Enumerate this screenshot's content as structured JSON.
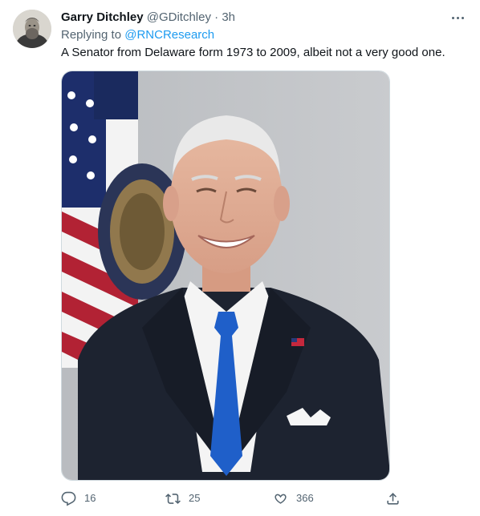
{
  "tweet": {
    "display_name": "Garry Ditchley",
    "handle": "@GDitchley",
    "separator": "·",
    "time": "3h",
    "replying_prefix": "Replying to",
    "replying_handle": "@RNCResearch",
    "text": "A Senator from Delaware form 1973 to 2009, albeit not a very good one.",
    "image_subject": "official portrait of a smiling man in a dark suit and blue tie in front of an American flag"
  },
  "actions": {
    "reply_count": "16",
    "retweet_count": "25",
    "like_count": "366"
  },
  "icons": {
    "more": "more-horizontal-icon",
    "reply": "reply-icon",
    "retweet": "retweet-icon",
    "like": "heart-icon",
    "share": "share-icon"
  },
  "colors": {
    "link": "#1d9bf0",
    "secondary_text": "#536471",
    "primary_text": "#0f1419",
    "background": "#ffffff",
    "border": "#cfd9de"
  }
}
